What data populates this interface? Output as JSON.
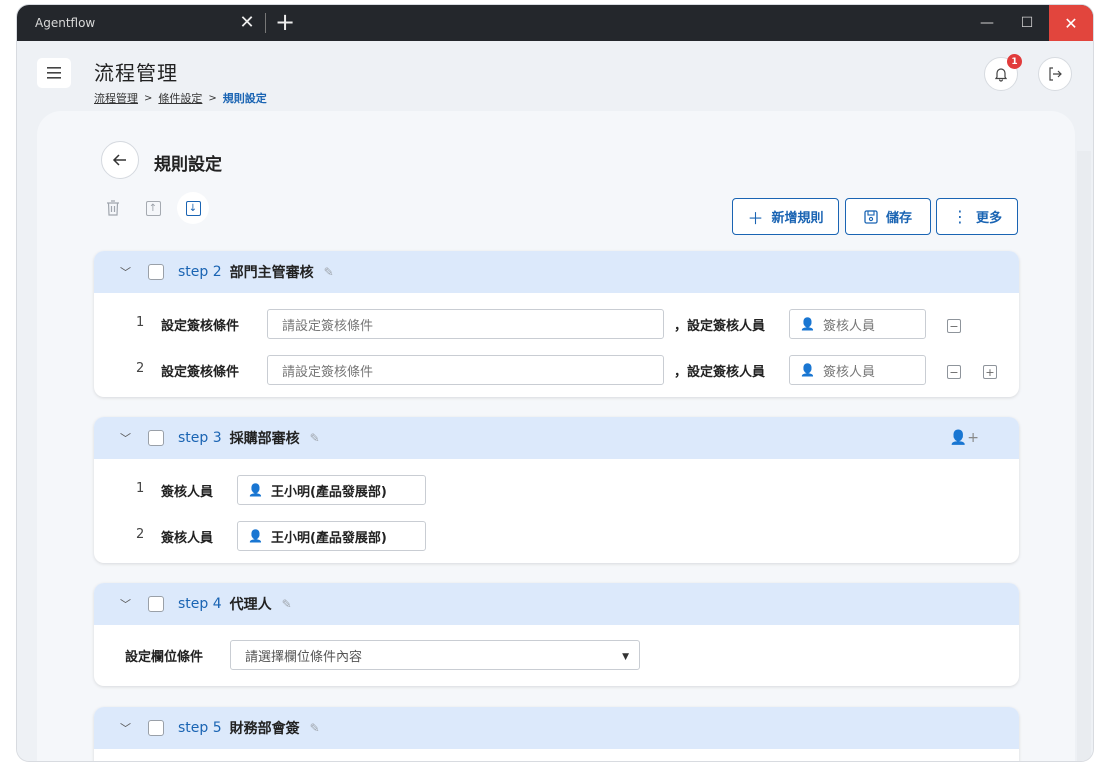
{
  "window": {
    "tab_title": "Agentflow",
    "tab_close": "✕",
    "new_tab": "+",
    "minimize": "—",
    "maximize": "☐",
    "close": "✕"
  },
  "header": {
    "menu_icon": "hamburger-icon",
    "title": "流程管理",
    "breadcrumb": [
      "流程管理",
      "條件設定",
      "規則設定"
    ],
    "breadcrumb_sep": ">",
    "notification_count": "1"
  },
  "section": {
    "title": "規則設定"
  },
  "toolbar": {
    "add_label": "新增規則",
    "save_label": "儲存",
    "more_label": "更多"
  },
  "steps": [
    {
      "label": "step 2",
      "name": "部門主管審核",
      "rows": [
        {
          "index": "1",
          "condition_label": "設定簽核條件",
          "condition_placeholder": "請設定簽核條件",
          "approver_label": "，設定簽核人員",
          "approver_placeholder": "簽核人員"
        },
        {
          "index": "2",
          "condition_label": "設定簽核條件",
          "condition_placeholder": "請設定簽核條件",
          "approver_label": "，設定簽核人員",
          "approver_placeholder": "簽核人員"
        }
      ]
    },
    {
      "label": "step 3",
      "name": "採購部審核",
      "rows": [
        {
          "index": "1",
          "approver_label": "簽核人員",
          "approver_value": "王小明(產品發展部)"
        },
        {
          "index": "2",
          "approver_label": "簽核人員",
          "approver_value": "王小明(產品發展部)"
        }
      ]
    },
    {
      "label": "step 4",
      "name": "代理人",
      "field_label": "設定欄位條件",
      "field_placeholder": "請選擇欄位條件內容"
    },
    {
      "label": "step 5",
      "name": "財務部會簽"
    }
  ],
  "colors": {
    "accent": "#1a64b3",
    "card_header": "#dce9fb",
    "badge": "#e13b3b",
    "titlebar": "#24272c"
  }
}
